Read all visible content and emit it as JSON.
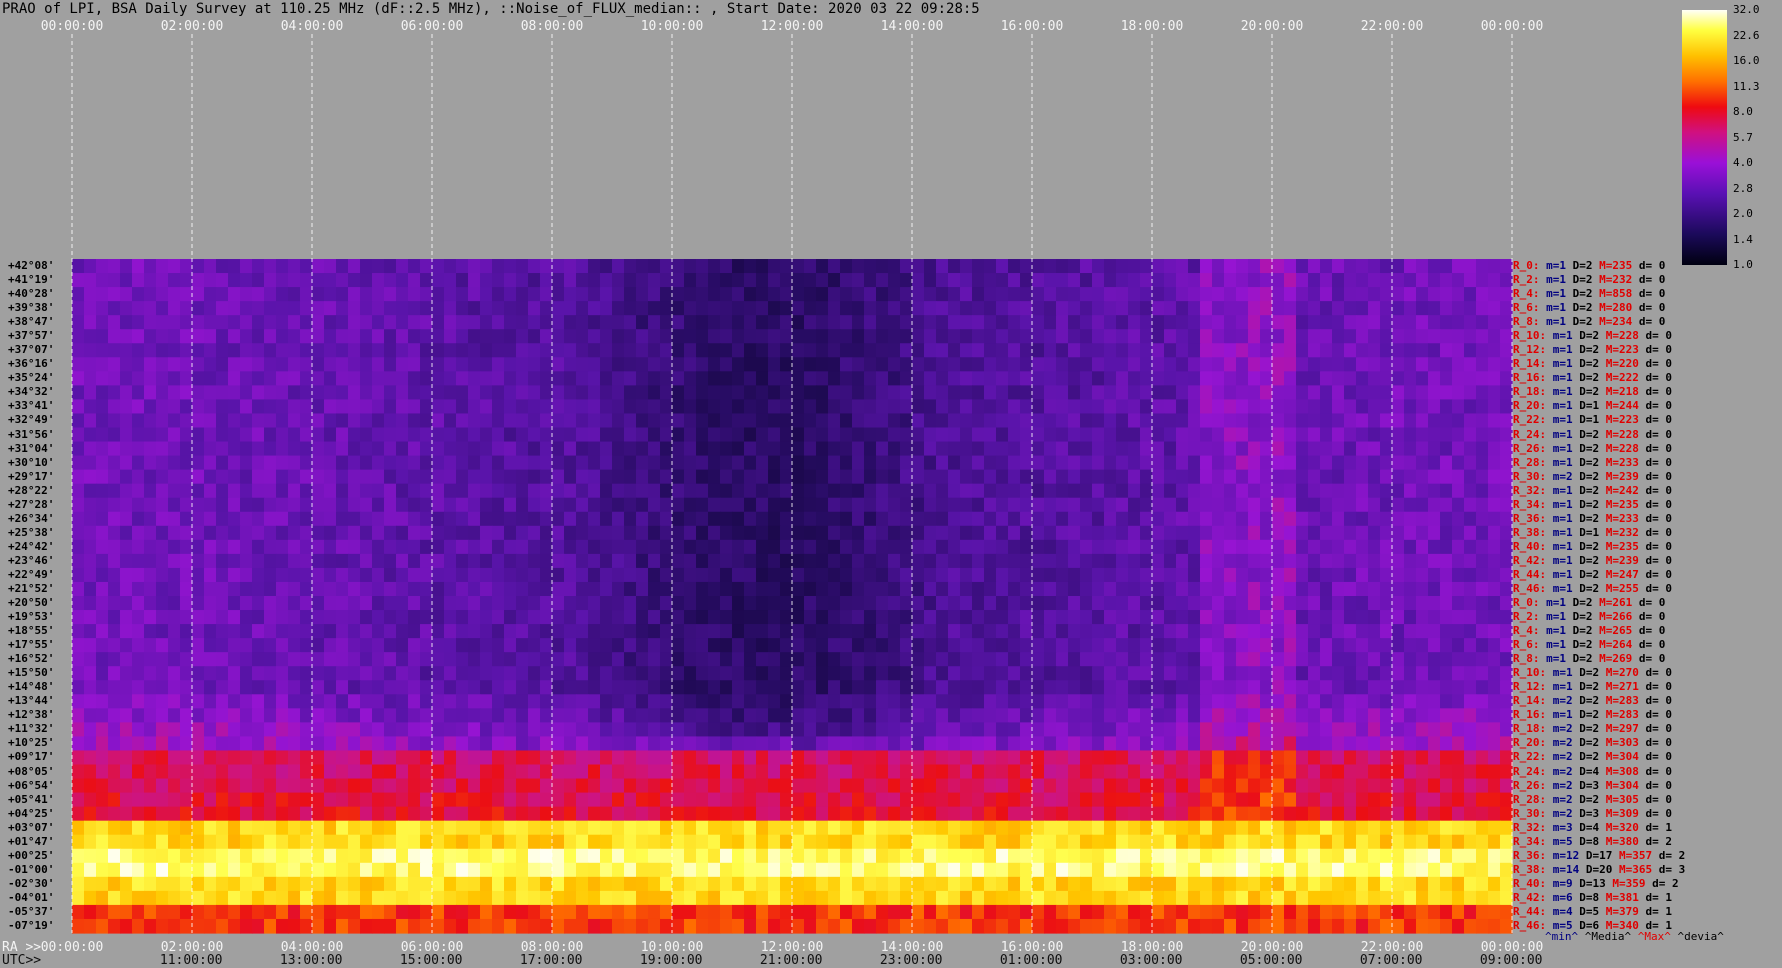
{
  "title": "PRAO of LPI, BSA Daily Survey at 110.25 MHz (dF::2.5 MHz), ::Noise_of_FLUX_median:: , Start Date: 2020 03 22 09:28:5",
  "colors": {
    "background": "#a0a0a0",
    "plot_background": "#2a0a66",
    "grid": "#ffffff"
  },
  "chart_data": {
    "type": "heatmap",
    "title": "PRAO of LPI, BSA Daily Survey at 110.25 MHz (dF::2.5 MHz), ::Noise_of_FLUX_median:: , Start Date: 2020 03 22 09:28:5",
    "top_ticks": [
      "00:00:00",
      "02:00:00",
      "04:00:00",
      "06:00:00",
      "08:00:00",
      "10:00:00",
      "12:00:00",
      "14:00:00",
      "16:00:00",
      "18:00:00",
      "20:00:00",
      "22:00:00",
      "00:00:00"
    ],
    "ra_prefix": "RA >>",
    "ra_ticks": [
      "00:00:00",
      "02:00:00",
      "04:00:00",
      "06:00:00",
      "08:00:00",
      "10:00:00",
      "12:00:00",
      "14:00:00",
      "16:00:00",
      "18:00:00",
      "20:00:00",
      "22:00:00",
      "00:00:00"
    ],
    "utc_prefix": "UTC>>",
    "utc_ticks": [
      "11:00:00",
      "13:00:00",
      "15:00:00",
      "17:00:00",
      "19:00:00",
      "21:00:00",
      "23:00:00",
      "01:00:00",
      "03:00:00",
      "05:00:00",
      "07:00:00",
      "09:00:00"
    ],
    "declinations": [
      "+42°08'",
      "+41°19'",
      "+40°28'",
      "+39°38'",
      "+38°47'",
      "+37°57'",
      "+37°07'",
      "+36°16'",
      "+35°24'",
      "+34°32'",
      "+33°41'",
      "+32°49'",
      "+31°56'",
      "+31°04'",
      "+30°10'",
      "+29°17'",
      "+28°22'",
      "+27°28'",
      "+26°34'",
      "+25°38'",
      "+24°42'",
      "+23°46'",
      "+22°49'",
      "+21°52'",
      "+20°50'",
      "+19°53'",
      "+18°55'",
      "+17°55'",
      "+16°52'",
      "+15°50'",
      "+14°48'",
      "+13°44'",
      "+12°38'",
      "+11°32'",
      "+10°25'",
      "+09°17'",
      "+08°05'",
      "+06°54'",
      "+05°41'",
      "+04°25'",
      "+03°07'",
      "+01°47'",
      "+00°25'",
      "-01°00'",
      "-02°30'",
      "-04°01'",
      "-05°37'",
      "-07°19'"
    ],
    "colorbar": {
      "ticks": [
        "32.0",
        "22.6",
        "16.0",
        "11.3",
        "8.0",
        "5.7",
        "4.0",
        "2.8",
        "2.0",
        "1.4",
        "1.0"
      ]
    },
    "stats_header": [
      "^min^",
      "^Media^",
      "^Max^",
      "^devia^"
    ],
    "stats": [
      {
        "r": "R_0:",
        "m": "m=1",
        "D": "D=2",
        "M": "M=235",
        "d": "d= 0"
      },
      {
        "r": "R_2:",
        "m": "m=1",
        "D": "D=2",
        "M": "M=232",
        "d": "d= 0"
      },
      {
        "r": "R_4:",
        "m": "m=1",
        "D": "D=2",
        "M": "M=858",
        "d": "d= 0"
      },
      {
        "r": "R_6:",
        "m": "m=1",
        "D": "D=2",
        "M": "M=280",
        "d": "d= 0"
      },
      {
        "r": "R_8:",
        "m": "m=1",
        "D": "D=2",
        "M": "M=234",
        "d": "d= 0"
      },
      {
        "r": "R_10:",
        "m": "m=1",
        "D": "D=2",
        "M": "M=228",
        "d": "d= 0"
      },
      {
        "r": "R_12:",
        "m": "m=1",
        "D": "D=2",
        "M": "M=223",
        "d": "d= 0"
      },
      {
        "r": "R_14:",
        "m": "m=1",
        "D": "D=2",
        "M": "M=220",
        "d": "d= 0"
      },
      {
        "r": "R_16:",
        "m": "m=1",
        "D": "D=2",
        "M": "M=222",
        "d": "d= 0"
      },
      {
        "r": "R_18:",
        "m": "m=1",
        "D": "D=2",
        "M": "M=218",
        "d": "d= 0"
      },
      {
        "r": "R_20:",
        "m": "m=1",
        "D": "D=1",
        "M": "M=244",
        "d": "d= 0"
      },
      {
        "r": "R_22:",
        "m": "m=1",
        "D": "D=1",
        "M": "M=223",
        "d": "d= 0"
      },
      {
        "r": "R_24:",
        "m": "m=1",
        "D": "D=2",
        "M": "M=228",
        "d": "d= 0"
      },
      {
        "r": "R_26:",
        "m": "m=1",
        "D": "D=2",
        "M": "M=228",
        "d": "d= 0"
      },
      {
        "r": "R_28:",
        "m": "m=1",
        "D": "D=2",
        "M": "M=233",
        "d": "d= 0"
      },
      {
        "r": "R_30:",
        "m": "m=2",
        "D": "D=2",
        "M": "M=239",
        "d": "d= 0"
      },
      {
        "r": "R_32:",
        "m": "m=1",
        "D": "D=2",
        "M": "M=242",
        "d": "d= 0"
      },
      {
        "r": "R_34:",
        "m": "m=1",
        "D": "D=2",
        "M": "M=235",
        "d": "d= 0"
      },
      {
        "r": "R_36:",
        "m": "m=1",
        "D": "D=2",
        "M": "M=233",
        "d": "d= 0"
      },
      {
        "r": "R_38:",
        "m": "m=1",
        "D": "D=1",
        "M": "M=232",
        "d": "d= 0"
      },
      {
        "r": "R_40:",
        "m": "m=1",
        "D": "D=2",
        "M": "M=235",
        "d": "d= 0"
      },
      {
        "r": "R_42:",
        "m": "m=1",
        "D": "D=2",
        "M": "M=239",
        "d": "d= 0"
      },
      {
        "r": "R_44:",
        "m": "m=1",
        "D": "D=2",
        "M": "M=247",
        "d": "d= 0"
      },
      {
        "r": "R_46:",
        "m": "m=1",
        "D": "D=2",
        "M": "M=255",
        "d": "d= 0"
      },
      {
        "r": "R_0:",
        "m": "m=1",
        "D": "D=2",
        "M": "M=261",
        "d": "d= 0"
      },
      {
        "r": "R_2:",
        "m": "m=1",
        "D": "D=2",
        "M": "M=266",
        "d": "d= 0"
      },
      {
        "r": "R_4:",
        "m": "m=1",
        "D": "D=2",
        "M": "M=265",
        "d": "d= 0"
      },
      {
        "r": "R_6:",
        "m": "m=1",
        "D": "D=2",
        "M": "M=264",
        "d": "d= 0"
      },
      {
        "r": "R_8:",
        "m": "m=1",
        "D": "D=2",
        "M": "M=269",
        "d": "d= 0"
      },
      {
        "r": "R_10:",
        "m": "m=1",
        "D": "D=2",
        "M": "M=270",
        "d": "d= 0"
      },
      {
        "r": "R_12:",
        "m": "m=1",
        "D": "D=2",
        "M": "M=271",
        "d": "d= 0"
      },
      {
        "r": "R_14:",
        "m": "m=2",
        "D": "D=2",
        "M": "M=283",
        "d": "d= 0"
      },
      {
        "r": "R_16:",
        "m": "m=1",
        "D": "D=2",
        "M": "M=283",
        "d": "d= 0"
      },
      {
        "r": "R_18:",
        "m": "m=2",
        "D": "D=2",
        "M": "M=297",
        "d": "d= 0"
      },
      {
        "r": "R_20:",
        "m": "m=2",
        "D": "D=2",
        "M": "M=303",
        "d": "d= 0"
      },
      {
        "r": "R_22:",
        "m": "m=2",
        "D": "D=2",
        "M": "M=304",
        "d": "d= 0"
      },
      {
        "r": "R_24:",
        "m": "m=2",
        "D": "D=4",
        "M": "M=308",
        "d": "d= 0"
      },
      {
        "r": "R_26:",
        "m": "m=2",
        "D": "D=3",
        "M": "M=304",
        "d": "d= 0"
      },
      {
        "r": "R_28:",
        "m": "m=2",
        "D": "D=2",
        "M": "M=305",
        "d": "d= 0"
      },
      {
        "r": "R_30:",
        "m": "m=2",
        "D": "D=3",
        "M": "M=309",
        "d": "d= 0"
      },
      {
        "r": "R_32:",
        "m": "m=3",
        "D": "D=4",
        "M": "M=320",
        "d": "d= 1"
      },
      {
        "r": "R_34:",
        "m": "m=5",
        "D": "D=8",
        "M": "M=380",
        "d": "d= 2"
      },
      {
        "r": "R_36:",
        "m": "m=12",
        "D": "D=17",
        "M": "M=357",
        "d": "d= 2"
      },
      {
        "r": "R_38:",
        "m": "m=14",
        "D": "D=20",
        "M": "M=365",
        "d": "d= 3"
      },
      {
        "r": "R_40:",
        "m": "m=9",
        "D": "D=13",
        "M": "M=359",
        "d": "d= 2"
      },
      {
        "r": "R_42:",
        "m": "m=6",
        "D": "D=8",
        "M": "M=381",
        "d": "d= 1"
      },
      {
        "r": "R_44:",
        "m": "m=4",
        "D": "D=5",
        "M": "M=379",
        "d": "d= 1"
      },
      {
        "r": "R_46:",
        "m": "m=5",
        "D": "D=6",
        "M": "M=340",
        "d": "d= 1"
      }
    ]
  }
}
